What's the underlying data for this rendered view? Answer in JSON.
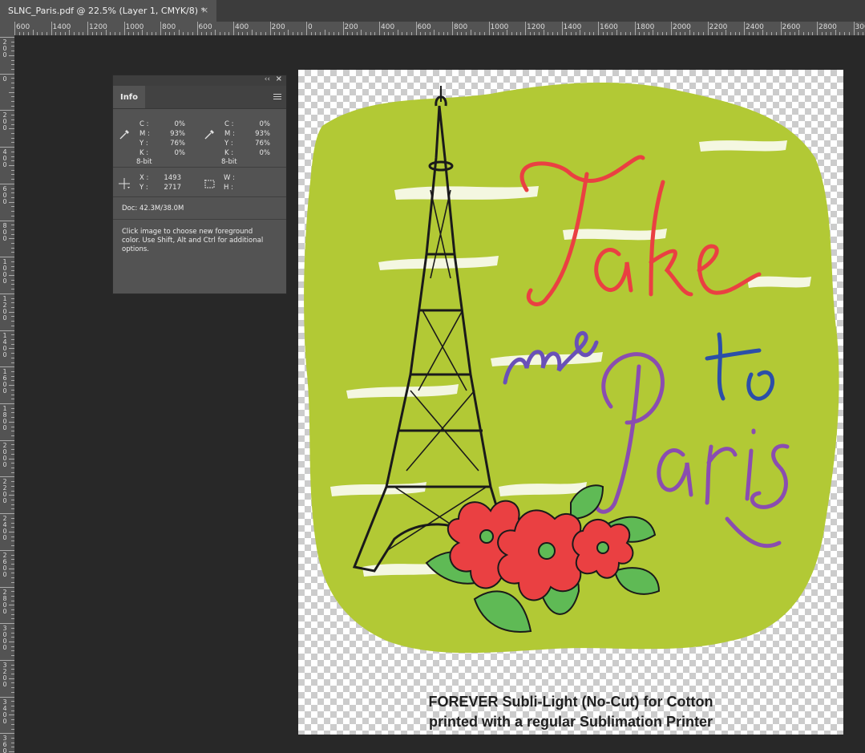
{
  "document_tab": {
    "title": "SLNC_Paris.pdf @ 22.5% (Layer 1, CMYK/8) *",
    "close_glyph": "×"
  },
  "ruler_top": [
    "600",
    "1400",
    "1200",
    "1000",
    "800",
    "600",
    "400",
    "200",
    "0",
    "200",
    "400",
    "600",
    "800",
    "1000",
    "1200",
    "1400",
    "1600",
    "1800",
    "2000",
    "2200",
    "2400",
    "2600",
    "2800",
    "3000"
  ],
  "ruler_left": [
    "200",
    "0",
    "200",
    "400",
    "600",
    "800",
    "1000",
    "1200",
    "1400",
    "1600",
    "1800",
    "2000",
    "2200",
    "2400",
    "2600",
    "2800",
    "3000",
    "3200",
    "3400",
    "3600"
  ],
  "info_panel": {
    "tab_label": "Info",
    "collapse_glyph": "‹‹",
    "close_glyph": "×",
    "color_readout_1": {
      "rows": [
        {
          "k": "C :",
          "v": "0%"
        },
        {
          "k": "M :",
          "v": "93%"
        },
        {
          "k": "Y :",
          "v": "76%"
        },
        {
          "k": "K :",
          "v": "0%"
        }
      ],
      "bit_depth": "8-bit"
    },
    "color_readout_2": {
      "rows": [
        {
          "k": "C :",
          "v": "0%"
        },
        {
          "k": "M :",
          "v": "93%"
        },
        {
          "k": "Y :",
          "v": "76%"
        },
        {
          "k": "K :",
          "v": "0%"
        }
      ],
      "bit_depth": "8-bit"
    },
    "position": {
      "x_label": "X :",
      "x_value": "1493",
      "y_label": "Y :",
      "y_value": "2717"
    },
    "size": {
      "w_label": "W :",
      "w_value": "",
      "h_label": "H :",
      "h_value": ""
    },
    "doc_size": "Doc: 42.3M/38.0M",
    "help_text": "Click image to choose new foreground color.  Use Shift, Alt and Ctrl for additional options."
  },
  "artwork": {
    "caption_line1": "FOREVER Subli-Light (No-Cut) for Cotton",
    "caption_line2": "printed with a regular Sublimation Printer",
    "lettering": "Take me to Paris",
    "colors": {
      "green": "#b2c935",
      "red": "#ea4042",
      "purple": "#8a4db0",
      "blue": "#2c4fa8",
      "leaf": "#5fba55",
      "black": "#1a1a1a"
    }
  },
  "icons": [
    "eyedropper-icon",
    "crosshair-icon",
    "selection-rect-icon",
    "panel-menu-icon",
    "close-icon",
    "collapse-icon"
  ]
}
